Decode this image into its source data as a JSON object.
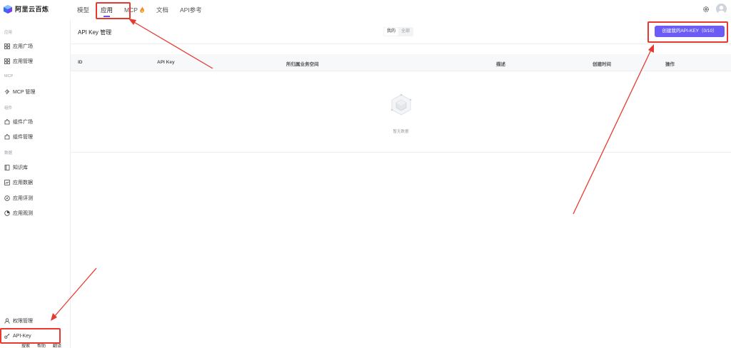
{
  "brand": {
    "name": "阿里云百炼"
  },
  "nav": {
    "items": [
      {
        "label": "模型"
      },
      {
        "label": "应用"
      },
      {
        "label": "MCP"
      },
      {
        "label": "文档"
      },
      {
        "label": "API参考"
      }
    ],
    "active": "应用"
  },
  "sidebar": {
    "sections": [
      {
        "label": "应用",
        "items": [
          "应用广场",
          "应用管理"
        ]
      },
      {
        "label": "MCP",
        "items": [
          "MCP 管理"
        ]
      },
      {
        "label": "组件",
        "items": [
          "组件广场",
          "组件管理"
        ]
      },
      {
        "label": "数据",
        "items": [
          "知识库",
          "应用数据",
          "应用评测",
          "应用观测"
        ]
      }
    ],
    "bottom_items": [
      "权限管理",
      "API-Key"
    ],
    "bottom_fragment": [
      "搜索",
      "帮助",
      "翻译"
    ]
  },
  "page": {
    "title": "API Key 管理",
    "filter": {
      "options": [
        "我的",
        "全部"
      ],
      "selected": "我的"
    },
    "create_button": "创建我的API-KEY（0/10）",
    "table": {
      "columns": [
        "ID",
        "API Key",
        "所归属业务空间",
        "描述",
        "创建时间",
        "操作"
      ],
      "rows": [],
      "empty_text": "暂无数据"
    }
  },
  "colors": {
    "accent": "#6b5cf6",
    "annotation": "#e8392f"
  }
}
